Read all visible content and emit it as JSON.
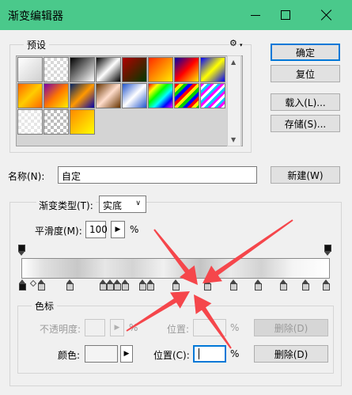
{
  "window": {
    "title": "渐变编辑器"
  },
  "presets": {
    "label": "预设",
    "gear_glyph": "⚙",
    "swatches": [
      "linear-gradient(135deg,#ffffff,#cfcfcf)",
      "repeating-conic-gradient(#d8d8d8 0 25%, #ffffff 0 50%) 0 0/8px 8px",
      "linear-gradient(135deg,#000000,#ffffff)",
      "linear-gradient(135deg,#000000,#ffffff,#000000)",
      "linear-gradient(135deg,#b00000,#003a00)",
      "linear-gradient(135deg,#ff2a00,#ffee00)",
      "linear-gradient(135deg,#0000aa,#ff0000,#ffee00)",
      "linear-gradient(135deg,#0000ff,#ffff00,#0000ff)",
      "linear-gradient(135deg,#ff6600,#ffcc00,#ff6600)",
      "linear-gradient(135deg,#7a00aa,#ff7700,#ffee00)",
      "linear-gradient(135deg,#002266,#ff9900,#0000aa)",
      "linear-gradient(135deg,#663300,#ffddcc,#663300)",
      "linear-gradient(135deg,#2255cc,#ffffff,#2255cc)",
      "linear-gradient(135deg,#ff0000,#ffff00,#00ff00,#00ffff,#0000ff,#ff00ff)",
      "repeating-linear-gradient(135deg,#ff0000 0 4px,#ffee00 4px 8px,#00cc00 8px 12px,#0000ff 12px 16px)",
      "repeating-linear-gradient(135deg,#ff00ff 0 3px,#ffffff 3px 6px,#00ccff 6px 9px)",
      "repeating-conic-gradient(#e6e6e6 0 25%, #ffffff 0 50%) 0 0/8px 8px",
      "repeating-conic-gradient(#bdbdbd 0 25%, #ffffff 0 50%) 0 0/8px 8px",
      "linear-gradient(135deg,#ff8800,#ffff00)"
    ]
  },
  "buttons": {
    "ok": "确定",
    "reset": "复位",
    "load": "载入(L)...",
    "save": "存储(S)...",
    "new": "新建(W)"
  },
  "name": {
    "label": "名称(N):",
    "value": "自定"
  },
  "gradient_type": {
    "label": "渐变类型(T):",
    "value": "实底"
  },
  "smoothness": {
    "label": "平滑度(M):",
    "value": "100",
    "unit": "%"
  },
  "color_stops": {
    "label": "色标",
    "opacity_label": "不透明度:",
    "opacity_unit": "%",
    "opacity_location_label": "位置:",
    "opacity_location_unit": "%",
    "delete_disabled": "删除(D)",
    "color_label": "颜色:",
    "location_label": "位置(C):",
    "location_value": "",
    "location_unit": "%",
    "delete": "删除(D)"
  },
  "colors": {
    "titlebar": "#4ac98b",
    "annotation_arrow": "#f5464b",
    "focus": "#0078d7"
  }
}
